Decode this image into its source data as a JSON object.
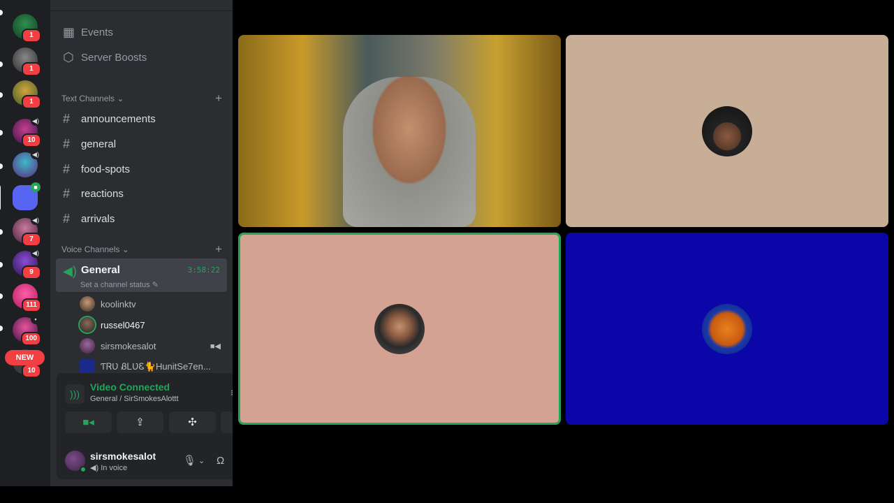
{
  "sidebar": {
    "top_items": [
      {
        "label": "Events",
        "icon": "calendar-icon"
      },
      {
        "label": "Server Boosts",
        "icon": "boost-icon"
      }
    ],
    "text_category": "Text Channels",
    "text_channels": [
      "announcements",
      "general",
      "food-spots",
      "reactions",
      "arrivals"
    ],
    "voice_category": "Voice Channels",
    "voice_channel": {
      "name": "General",
      "timer": "3:58:22",
      "status_placeholder": "Set a channel status"
    },
    "members": [
      {
        "name": "koolinktv"
      },
      {
        "name": "russel0467"
      },
      {
        "name": "sirsmokesalot"
      },
      {
        "name": "ƬᏒƲ ᏰᏞƲᏋ🐈HunitSe7en..."
      }
    ]
  },
  "rail": {
    "badges": [
      "1",
      "1",
      "1",
      "10",
      "7",
      "9",
      "111",
      "100",
      "10"
    ],
    "new_label": "NEW"
  },
  "voice_panel": {
    "title": "Video Connected",
    "subtitle": "General / SirSmokesAlottt",
    "user_name": "sirsmokesalot",
    "user_status": "In voice"
  },
  "colors": {
    "accent_green": "#23a55a",
    "badge_red": "#f23f43",
    "tile_tan": "#c9ae97",
    "tile_pink": "#d4a292",
    "tile_blue": "#0a06a8"
  }
}
